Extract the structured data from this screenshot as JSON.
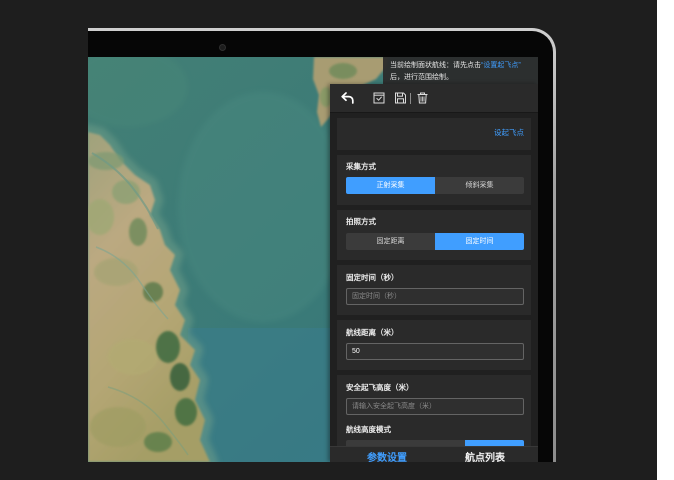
{
  "colors": {
    "accent": "#409eff"
  },
  "tooltip": {
    "text": "当前绘制面状航线：请先点击",
    "link": "“设置起飞点”",
    "text_after": "后，进行范围绘制。"
  },
  "toolbar": {
    "icons": [
      "undo-icon",
      "check-square-icon",
      "save-icon",
      "trash-icon"
    ]
  },
  "takeoff": {
    "link": "设起飞点"
  },
  "collect_method": {
    "label": "采集方式",
    "options": [
      "正射采集",
      "倾斜采集"
    ],
    "selected": 0
  },
  "photo_method": {
    "label": "拍照方式",
    "options": [
      "固定距离",
      "固定时间"
    ],
    "selected": 1
  },
  "fixed_time": {
    "label": "固定时间（秒）",
    "placeholder": "固定时间（秒）"
  },
  "route_distance": {
    "label": "航线距离（米）",
    "value": "50"
  },
  "safe_height": {
    "label": "安全起飞高度（米）",
    "placeholder": "请输入安全起飞高度（米）"
  },
  "height_mode": {
    "label": "航线高度模式",
    "selected": 2
  },
  "tabs": {
    "items": [
      "参数设置",
      "航点列表"
    ],
    "active": 0
  }
}
